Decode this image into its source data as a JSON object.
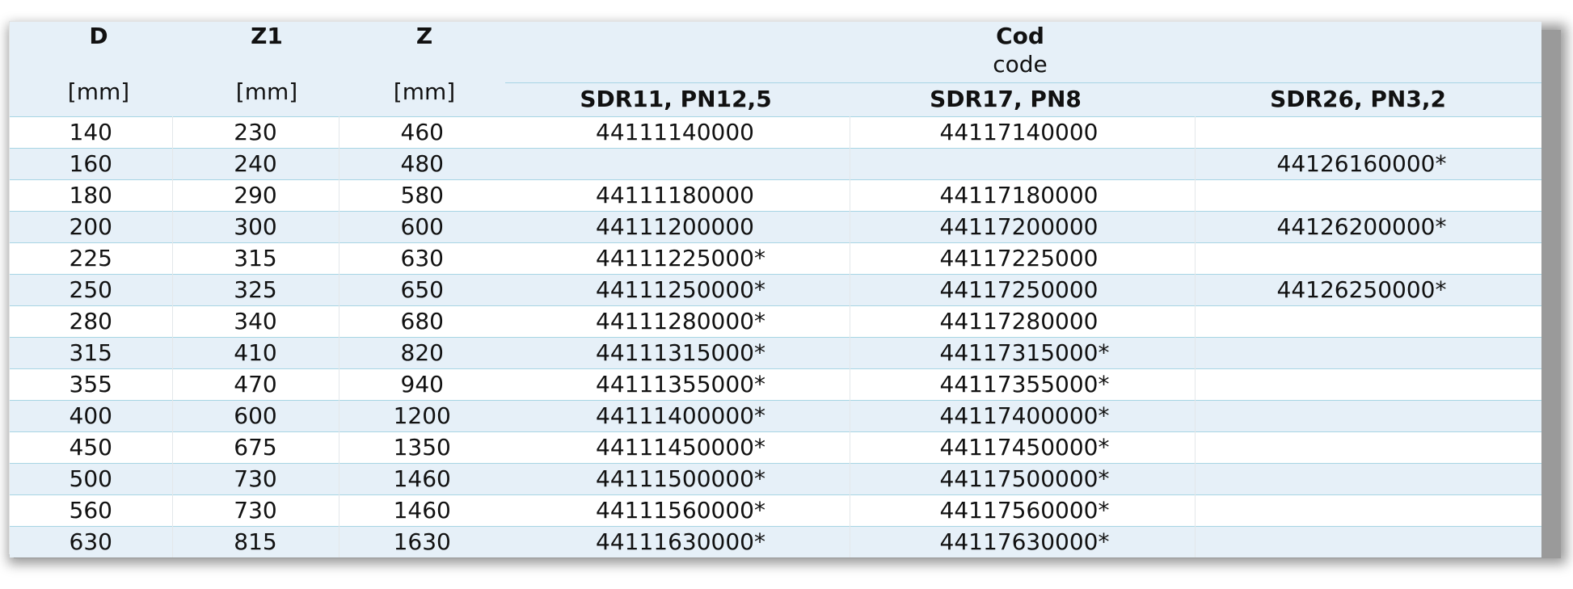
{
  "header": {
    "col_d": "D",
    "col_z1": "Z1",
    "col_z": "Z",
    "unit_d": "[mm]",
    "unit_z1": "[mm]",
    "unit_z": "[mm]",
    "cod": "Cod",
    "code": "code",
    "sdr11": "SDR11, PN12,5",
    "sdr17": "SDR17, PN8",
    "sdr26": "SDR26, PN3,2"
  },
  "rows": [
    {
      "d": "140",
      "z1": "230",
      "z": "460",
      "sdr11": "44111140000",
      "sdr17": "44117140000",
      "sdr26": ""
    },
    {
      "d": "160",
      "z1": "240",
      "z": "480",
      "sdr11": "",
      "sdr17": "",
      "sdr26": "44126160000*"
    },
    {
      "d": "180",
      "z1": "290",
      "z": "580",
      "sdr11": "44111180000",
      "sdr17": "44117180000",
      "sdr26": ""
    },
    {
      "d": "200",
      "z1": "300",
      "z": "600",
      "sdr11": "44111200000",
      "sdr17": "44117200000",
      "sdr26": "44126200000*"
    },
    {
      "d": "225",
      "z1": "315",
      "z": "630",
      "sdr11": "44111225000*",
      "sdr17": "44117225000",
      "sdr26": ""
    },
    {
      "d": "250",
      "z1": "325",
      "z": "650",
      "sdr11": "44111250000*",
      "sdr17": "44117250000",
      "sdr26": "44126250000*"
    },
    {
      "d": "280",
      "z1": "340",
      "z": "680",
      "sdr11": "44111280000*",
      "sdr17": "44117280000",
      "sdr26": ""
    },
    {
      "d": "315",
      "z1": "410",
      "z": "820",
      "sdr11": "44111315000*",
      "sdr17": "44117315000*",
      "sdr26": ""
    },
    {
      "d": "355",
      "z1": "470",
      "z": "940",
      "sdr11": "44111355000*",
      "sdr17": "44117355000*",
      "sdr26": ""
    },
    {
      "d": "400",
      "z1": "600",
      "z": "1200",
      "sdr11": "44111400000*",
      "sdr17": "44117400000*",
      "sdr26": ""
    },
    {
      "d": "450",
      "z1": "675",
      "z": "1350",
      "sdr11": "44111450000*",
      "sdr17": "44117450000*",
      "sdr26": ""
    },
    {
      "d": "500",
      "z1": "730",
      "z": "1460",
      "sdr11": "44111500000*",
      "sdr17": "44117500000*",
      "sdr26": ""
    },
    {
      "d": "560",
      "z1": "730",
      "z": "1460",
      "sdr11": "44111560000*",
      "sdr17": "44117560000*",
      "sdr26": ""
    },
    {
      "d": "630",
      "z1": "815",
      "z": "1630",
      "sdr11": "44111630000*",
      "sdr17": "44117630000*",
      "sdr26": ""
    }
  ]
}
